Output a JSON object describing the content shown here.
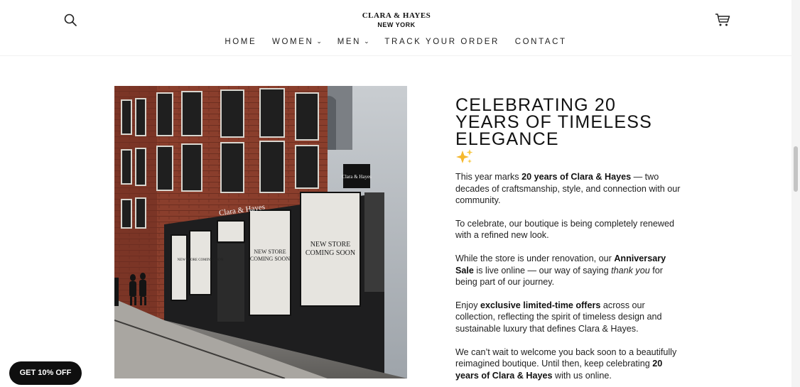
{
  "header": {
    "logo_brand": "CLARA & HAYES",
    "logo_city": "NEW YORK",
    "icons": {
      "search": "search-icon",
      "cart": "cart-icon"
    }
  },
  "nav": {
    "items": [
      {
        "label": "HOME",
        "has_dropdown": false
      },
      {
        "label": "WOMEN",
        "has_dropdown": true
      },
      {
        "label": "MEN",
        "has_dropdown": true
      },
      {
        "label": "TRACK YOUR ORDER",
        "has_dropdown": false
      },
      {
        "label": "CONTACT",
        "has_dropdown": false
      }
    ]
  },
  "hero_image": {
    "sign_building": "Clara & Hayes",
    "sign_blade": "Clara & Hayes",
    "window_text_1": "NEW STORE",
    "window_text_2": "COMING SOON",
    "window_small": "NEW STORE COMING SOON"
  },
  "content": {
    "headline": "CELEBRATING 20 YEARS OF TIMELESS ELEGANCE",
    "emoji": "sparkles-icon",
    "p1": {
      "t1": "This year marks ",
      "b1": "20 years of Clara & Hayes",
      "t2": " — two decades of craftsmanship, style, and connection with our community."
    },
    "p2": "To celebrate, our boutique is being completely renewed with a refined new look.",
    "p3": {
      "t1": "While the store is under renovation, our ",
      "b1": "Anniversary Sale",
      "t2": " is live online — our way of saying ",
      "i1": "thank you",
      "t3": " for being part of our journey."
    },
    "p4": {
      "t1": "Enjoy ",
      "b1": "exclusive limited-time offers",
      "t2": " across our collection, reflecting the spirit of timeless design and sustainable luxury that defines Clara & Hayes."
    },
    "p5": {
      "t1": "We can’t wait to welcome you back soon to a beautifully reimagined boutique. Until then, keep celebrating ",
      "b1": "20 years of Clara & Hayes",
      "t2": " with us online."
    }
  },
  "discount_button": {
    "label": "GET 10% OFF"
  },
  "colors": {
    "accent": "#0f0f0f",
    "text": "#222222",
    "brick": "#8a3e2c"
  }
}
